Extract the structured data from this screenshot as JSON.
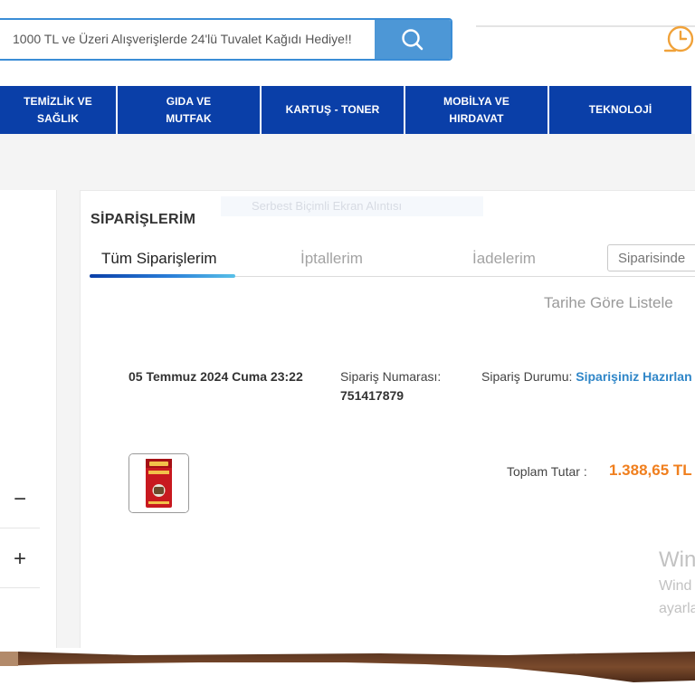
{
  "search": {
    "value": "1000 TL ve Üzeri Alışverişlerde 24'lü Tuvalet Kağıdı Hediye!!"
  },
  "icons": {
    "search": "search-icon",
    "clock": "clock-icon",
    "minus": "minus-icon",
    "plus": "plus-icon"
  },
  "categories": [
    {
      "label": "TEMİZLİK VE\nSAĞLIK"
    },
    {
      "label": "GIDA VE\nMUTFAK"
    },
    {
      "label": "KARTUŞ - TONER"
    },
    {
      "label": "MOBİLYA VE\nHIRDAVAT"
    },
    {
      "label": "TEKNOLOJİ"
    }
  ],
  "sidebar": {
    "collapse_symbol": "−",
    "expand_symbol": "+"
  },
  "orders": {
    "title": "SİPARİŞLERİM",
    "ghost_tooltip": "Serbest Biçimli Ekran Alıntısı",
    "tabs": [
      {
        "label": "Tüm Siparişlerim"
      },
      {
        "label": "İptallerim"
      },
      {
        "label": "İadelerim"
      }
    ],
    "search_placeholder": "Siparisinde",
    "sort_label": "Tarihe Göre Listele",
    "order": {
      "date": "05 Temmuz 2024 Cuma 23:22",
      "number_label": "Sipariş Numarası:",
      "number": "751417879",
      "status_label": "Sipariş Durumu:",
      "status": "Siparişiniz Hazırlan",
      "total_label": "Toplam Tutar :",
      "total": "1.388,65 TL"
    }
  },
  "watermark": {
    "title": "Win",
    "line1": "Wind",
    "line2": "ayarla"
  },
  "colors": {
    "nav_blue": "#0a3fa8",
    "accent_blue": "#4d97d6",
    "status_blue": "#2f86c8",
    "price_orange": "#f07f1e"
  }
}
